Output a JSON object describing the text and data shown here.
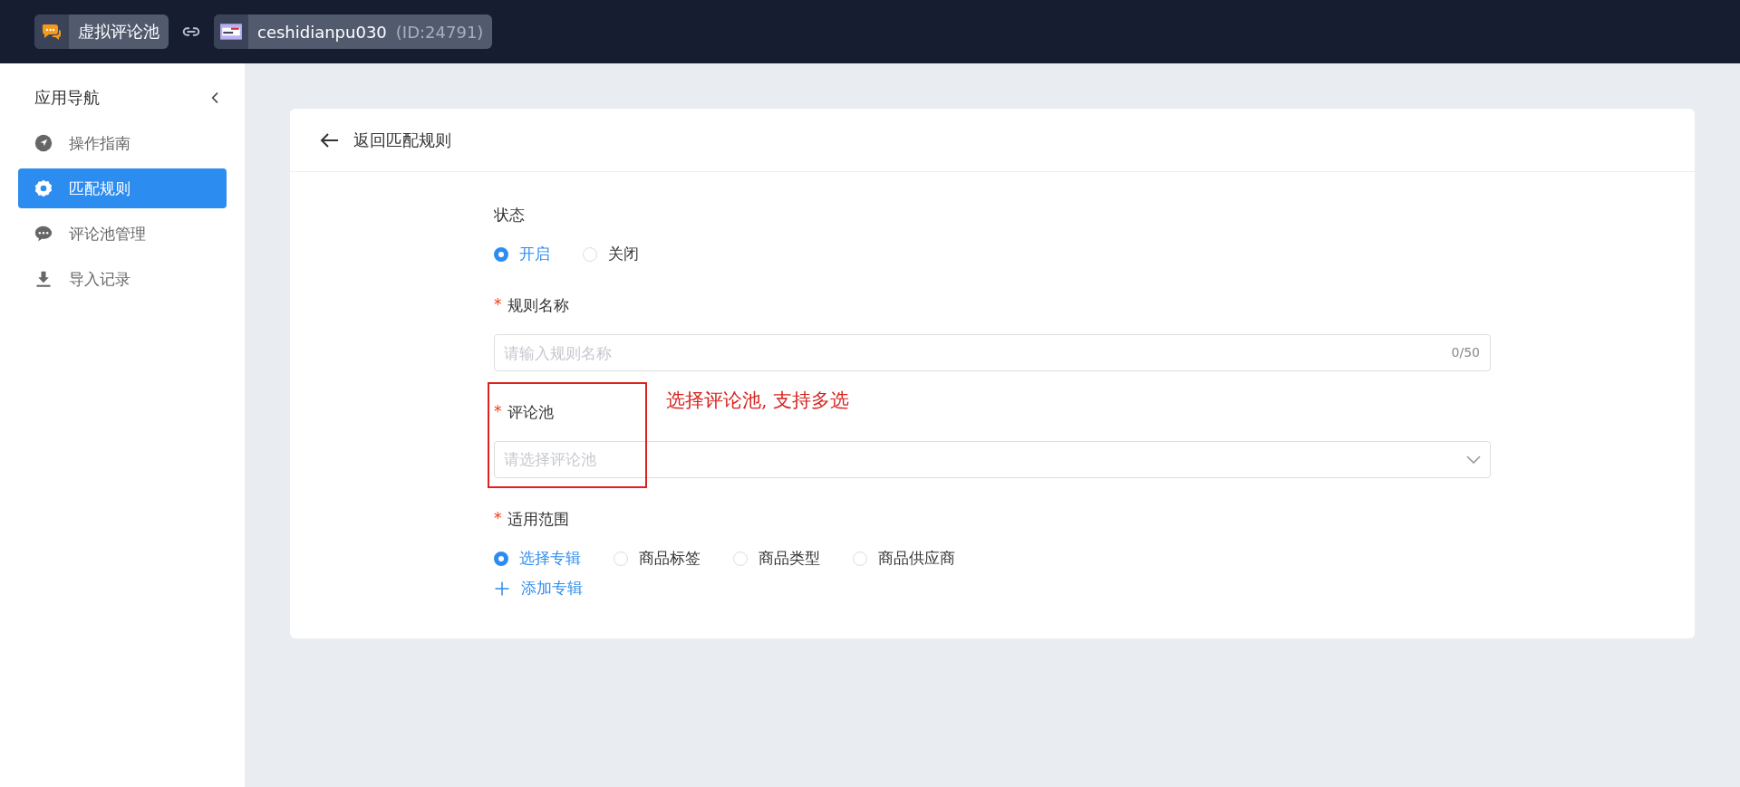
{
  "top_bar": {
    "app_name": "虚拟评论池",
    "store_name": "ceshidianpu030",
    "store_id": "(ID:24791)"
  },
  "sidebar": {
    "title": "应用导航",
    "items": [
      {
        "label": "操作指南",
        "selected": false
      },
      {
        "label": "匹配规则",
        "selected": true
      },
      {
        "label": "评论池管理",
        "selected": false
      },
      {
        "label": "导入记录",
        "selected": false
      }
    ]
  },
  "page": {
    "back_label": "返回匹配规则",
    "status": {
      "label": "状态",
      "options": [
        {
          "label": "开启",
          "selected": true
        },
        {
          "label": "关闭",
          "selected": false
        }
      ]
    },
    "rule_name": {
      "label": "规则名称",
      "required_mark": "*",
      "placeholder": "请输入规则名称",
      "counter": "0/50"
    },
    "comment_pool": {
      "label": "评论池",
      "required_mark": "*",
      "placeholder": "请选择评论池"
    },
    "scope": {
      "label": "适用范围",
      "required_mark": "*",
      "options": [
        {
          "label": "选择专辑",
          "selected": true
        },
        {
          "label": "商品标签",
          "selected": false
        },
        {
          "label": "商品类型",
          "selected": false
        },
        {
          "label": "商品供应商",
          "selected": false
        }
      ],
      "add_label": "添加专辑"
    },
    "annotation": "选择评论池, 支持多选"
  }
}
